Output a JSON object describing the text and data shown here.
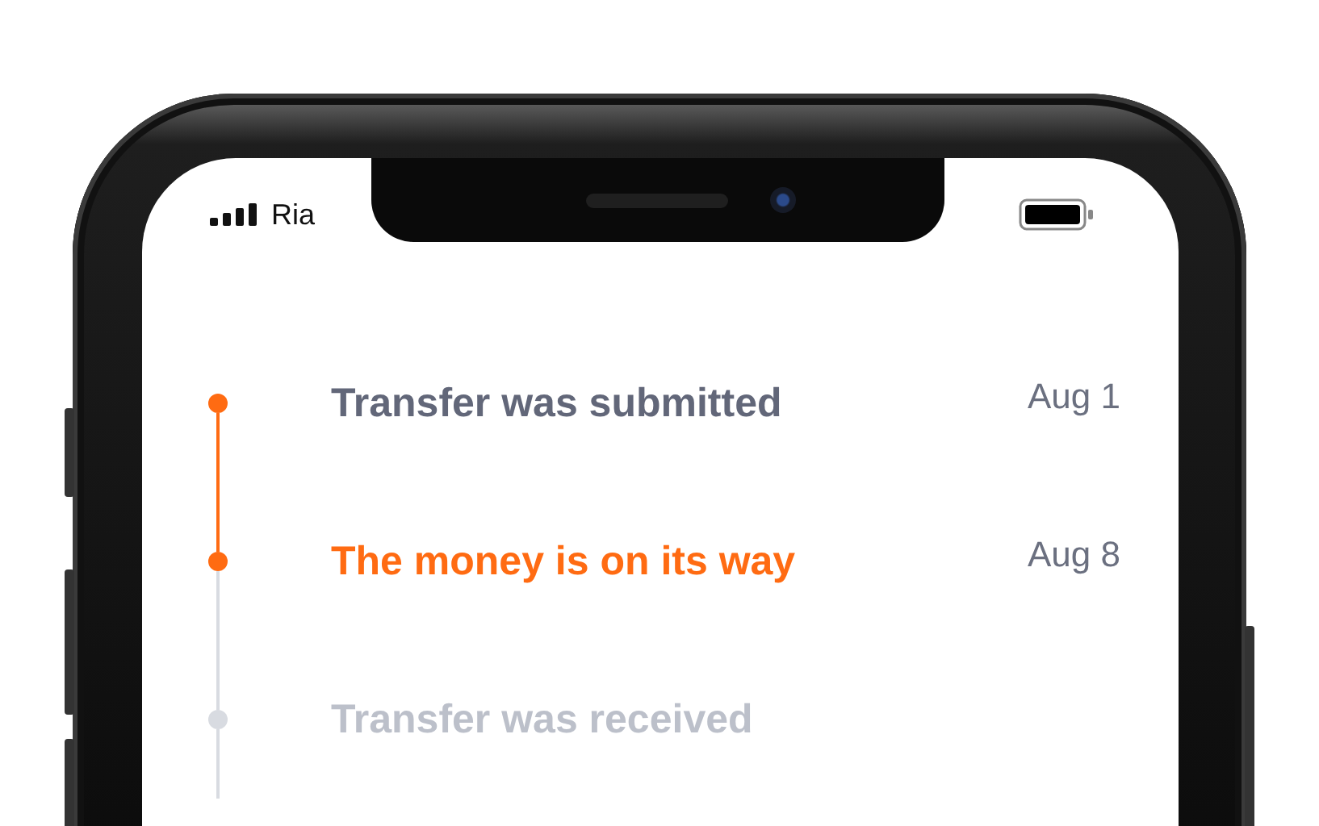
{
  "status_bar": {
    "carrier": "Ria"
  },
  "timeline": [
    {
      "title": "Transfer was submitted",
      "date": "Aug 1",
      "reached": true,
      "selected": false
    },
    {
      "title": "The money is on its way",
      "date": "Aug 8",
      "reached": true,
      "selected": true
    },
    {
      "title": "Transfer was received",
      "reached": false,
      "selected": false
    }
  ]
}
